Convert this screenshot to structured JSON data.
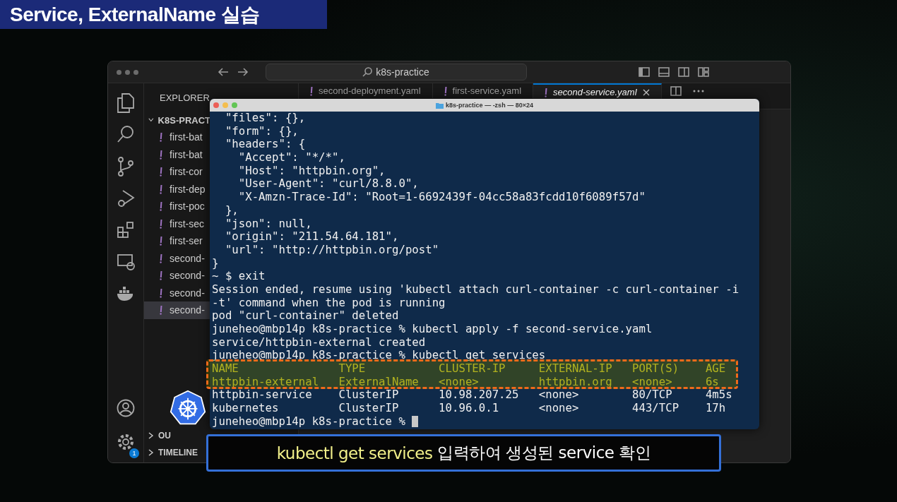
{
  "banner": {
    "title": "Service, ExternalName 실습"
  },
  "editor": {
    "search": "k8s-practice",
    "explorer_title": "EXPLORER",
    "project": "K8S-PRACT",
    "files": [
      {
        "name": "first-bat",
        "selected": false
      },
      {
        "name": "first-bat",
        "selected": false
      },
      {
        "name": "first-cor",
        "selected": false
      },
      {
        "name": "first-dep",
        "selected": false
      },
      {
        "name": "first-poc",
        "selected": false
      },
      {
        "name": "first-sec",
        "selected": false
      },
      {
        "name": "first-ser",
        "selected": false
      },
      {
        "name": "second-",
        "selected": false
      },
      {
        "name": "second-",
        "selected": false
      },
      {
        "name": "second-",
        "selected": false
      },
      {
        "name": "second-",
        "selected": true
      }
    ],
    "tabs": [
      {
        "label": "second-deployment.yaml",
        "selected": false
      },
      {
        "label": "first-service.yaml",
        "selected": false
      },
      {
        "label": "second-service.yaml",
        "selected": true
      }
    ],
    "sections": [
      "OU",
      "TIMELINE"
    ],
    "settings_badge": "1"
  },
  "terminal": {
    "title": "k8s-practice — -zsh — 80×24",
    "lines": [
      {
        "text": "  \"files\": {},",
        "kind": "plain"
      },
      {
        "text": "  \"form\": {},",
        "kind": "plain"
      },
      {
        "text": "  \"headers\": {",
        "kind": "plain"
      },
      {
        "text": "    \"Accept\": \"*/*\",",
        "kind": "plain"
      },
      {
        "text": "    \"Host\": \"httpbin.org\",",
        "kind": "plain"
      },
      {
        "text": "    \"User-Agent\": \"curl/8.8.0\",",
        "kind": "plain"
      },
      {
        "text": "    \"X-Amzn-Trace-Id\": \"Root=1-6692439f-04cc58a83fcdd10f6089f57d\"",
        "kind": "plain"
      },
      {
        "text": "  },",
        "kind": "plain"
      },
      {
        "text": "  \"json\": null,",
        "kind": "plain"
      },
      {
        "text": "  \"origin\": \"211.54.64.181\",",
        "kind": "plain"
      },
      {
        "text": "  \"url\": \"http://httpbin.org/post\"",
        "kind": "plain"
      },
      {
        "text": "}",
        "kind": "plain"
      },
      {
        "text": "~ $ exit",
        "kind": "plain"
      },
      {
        "text": "Session ended, resume using 'kubectl attach curl-container -c curl-container -i",
        "kind": "plain"
      },
      {
        "text": "-t' command when the pod is running",
        "kind": "plain"
      },
      {
        "text": "pod \"curl-container\" deleted",
        "kind": "plain"
      },
      {
        "text": "juneheo@mbp14p k8s-practice % kubectl apply -f second-service.yaml",
        "kind": "plain"
      },
      {
        "text": "service/httpbin-external created",
        "kind": "plain"
      },
      {
        "text": "juneheo@mbp14p k8s-practice % kubectl get services",
        "kind": "plain"
      },
      {
        "text": "NAME               TYPE           CLUSTER-IP     EXTERNAL-IP   PORT(S)    AGE",
        "kind": "highlight"
      },
      {
        "text": "httpbin-external   ExternalName   <none>         httpbin.org   <none>     6s",
        "kind": "highlight"
      },
      {
        "text": "httpbin-service    ClusterIP      10.98.207.25   <none>        80/TCP     4m5s",
        "kind": "plain"
      },
      {
        "text": "kubernetes         ClusterIP      10.96.0.1      <none>        443/TCP    17h",
        "kind": "plain"
      },
      {
        "text": "juneheo@mbp14p k8s-practice % ",
        "kind": "prompt"
      }
    ]
  },
  "caption": {
    "command": "kubectl get services",
    "text": "입력하여 생성된 service 확인"
  }
}
